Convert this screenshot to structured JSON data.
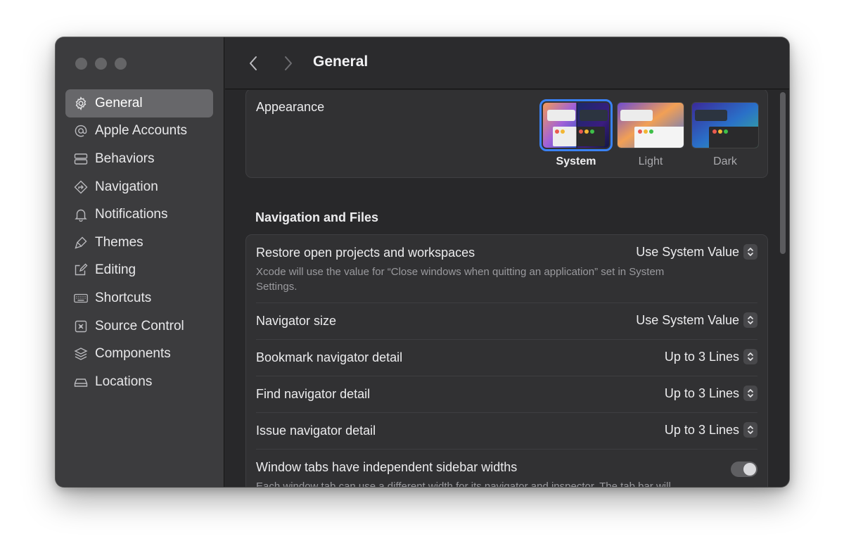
{
  "window": {
    "title": "General"
  },
  "sidebar": {
    "items": [
      {
        "label": "General",
        "icon": "gear-icon",
        "active": true
      },
      {
        "label": "Apple Accounts",
        "icon": "at-icon",
        "active": false
      },
      {
        "label": "Behaviors",
        "icon": "behaviors-icon",
        "active": false
      },
      {
        "label": "Navigation",
        "icon": "navigation-icon",
        "active": false
      },
      {
        "label": "Notifications",
        "icon": "bell-icon",
        "active": false
      },
      {
        "label": "Themes",
        "icon": "brush-icon",
        "active": false
      },
      {
        "label": "Editing",
        "icon": "edit-icon",
        "active": false
      },
      {
        "label": "Shortcuts",
        "icon": "keyboard-icon",
        "active": false
      },
      {
        "label": "Source Control",
        "icon": "source-control-icon",
        "active": false
      },
      {
        "label": "Components",
        "icon": "layers-icon",
        "active": false
      },
      {
        "label": "Locations",
        "icon": "drive-icon",
        "active": false
      }
    ]
  },
  "appearance": {
    "label": "Appearance",
    "options": [
      {
        "label": "System",
        "selected": true
      },
      {
        "label": "Light",
        "selected": false
      },
      {
        "label": "Dark",
        "selected": false
      }
    ]
  },
  "navigation_files": {
    "title": "Navigation and Files",
    "rows": [
      {
        "label": "Restore open projects and workspaces",
        "value": "Use System Value",
        "description": "Xcode will use the value for “Close windows when quitting an application” set in System Settings."
      },
      {
        "label": "Navigator size",
        "value": "Use System Value"
      },
      {
        "label": "Bookmark navigator detail",
        "value": "Up to 3 Lines"
      },
      {
        "label": "Find navigator detail",
        "value": "Up to 3 Lines"
      },
      {
        "label": "Issue navigator detail",
        "value": "Up to 3 Lines"
      },
      {
        "label": "Window tabs have independent sidebar widths",
        "toggle": false,
        "description": "Each window tab can use a different width for its navigator and inspector. The tab bar will"
      }
    ]
  },
  "colors": {
    "accent": "#3a82f6",
    "window_bg": "#28282a",
    "sidebar_bg": "#3c3c3e"
  }
}
